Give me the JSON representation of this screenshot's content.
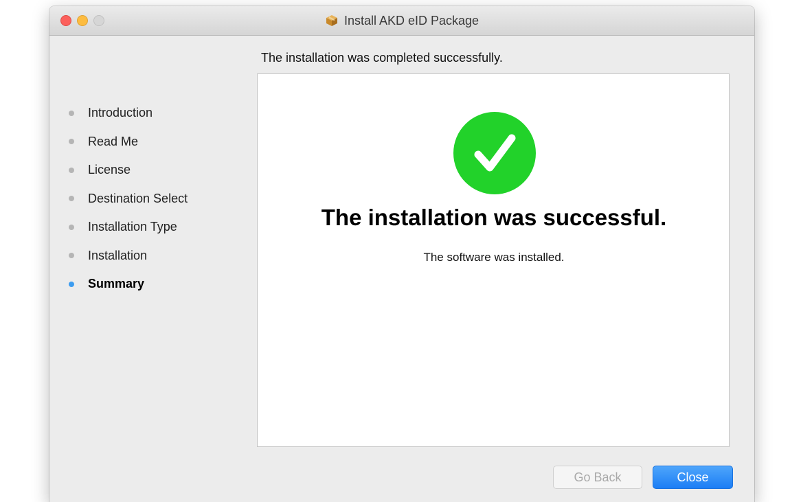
{
  "window": {
    "title": "Install AKD eID Package"
  },
  "header": {
    "status": "The installation was completed successfully."
  },
  "steps": [
    {
      "label": "Introduction",
      "active": false
    },
    {
      "label": "Read Me",
      "active": false
    },
    {
      "label": "License",
      "active": false
    },
    {
      "label": "Destination Select",
      "active": false
    },
    {
      "label": "Installation Type",
      "active": false
    },
    {
      "label": "Installation",
      "active": false
    },
    {
      "label": "Summary",
      "active": true
    }
  ],
  "summary": {
    "icon": "checkmark-circle-icon",
    "title": "The installation was successful.",
    "subtitle": "The software was installed."
  },
  "buttons": {
    "back_label": "Go Back",
    "back_enabled": false,
    "close_label": "Close"
  },
  "colors": {
    "success_green": "#22d22a",
    "accent_blue": "#1c7ef5",
    "active_step_dot": "#3c9cf0",
    "inactive_step_dot": "#b5b5b5"
  }
}
